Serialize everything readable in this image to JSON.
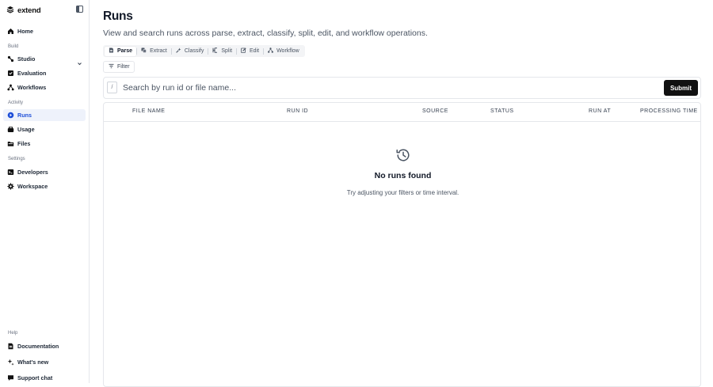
{
  "app": {
    "logo_text": "extend"
  },
  "sidebar": {
    "home_label": "Home",
    "sections": {
      "build": "Build",
      "activity": "Activity",
      "settings": "Settings",
      "help": "Help"
    },
    "build_items": [
      {
        "label": "Studio",
        "icon": "studio-icon",
        "has_chevron": true
      },
      {
        "label": "Evaluation",
        "icon": "evaluation-icon"
      },
      {
        "label": "Workflows",
        "icon": "workflows-icon"
      }
    ],
    "activity_items": [
      {
        "label": "Runs",
        "icon": "runs-icon",
        "active": true
      },
      {
        "label": "Usage",
        "icon": "usage-icon"
      },
      {
        "label": "Files",
        "icon": "files-icon"
      }
    ],
    "settings_items": [
      {
        "label": "Developers",
        "icon": "developers-icon"
      },
      {
        "label": "Workspace",
        "icon": "workspace-gear-icon"
      }
    ],
    "help_items": [
      {
        "label": "Documentation",
        "icon": "documentation-icon"
      },
      {
        "label": "What's new",
        "icon": "whats-new-icon"
      },
      {
        "label": "Support chat",
        "icon": "support-chat-icon"
      }
    ]
  },
  "main": {
    "title": "Runs",
    "subtitle": "View and search runs across parse, extract, classify, split, edit, and workflow operations.",
    "tabs": [
      {
        "label": "Parse",
        "icon": "parse-icon",
        "active": true
      },
      {
        "label": "Extract",
        "icon": "extract-icon"
      },
      {
        "label": "Classify",
        "icon": "classify-icon"
      },
      {
        "label": "Split",
        "icon": "split-icon"
      },
      {
        "label": "Edit",
        "icon": "edit-icon"
      },
      {
        "label": "Workflow",
        "icon": "workflow-icon"
      }
    ],
    "filter_label": "Filter",
    "search": {
      "shortcut": "/",
      "placeholder": "Search by run id or file name...",
      "value": "",
      "submit_label": "Submit"
    },
    "table": {
      "columns": [
        "FILE NAME",
        "RUN ID",
        "SOURCE",
        "STATUS",
        "RUN AT",
        "PROCESSING TIME"
      ],
      "rows": []
    },
    "empty_state": {
      "icon": "history-icon",
      "title": "No runs found",
      "subtitle": "Try adjusting your filters or time interval."
    }
  },
  "colors": {
    "accent": "#1d4ed8",
    "active_bg": "#eef2fb",
    "submit_bg": "#111111",
    "border": "#e5e7eb"
  }
}
